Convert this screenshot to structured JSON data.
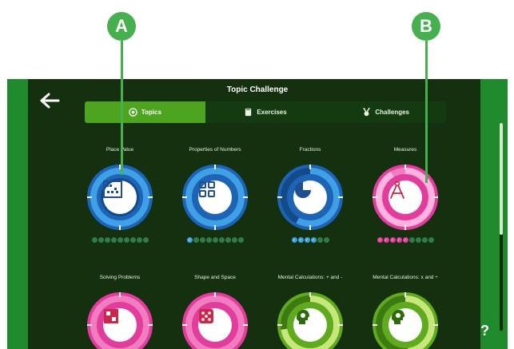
{
  "header": {
    "title": "Topic Challenge",
    "back_icon": "arrow-left-icon"
  },
  "tabs": [
    {
      "label": "Topics",
      "icon": "target-icon",
      "active": true
    },
    {
      "label": "Exercises",
      "icon": "book-icon",
      "active": false
    },
    {
      "label": "Challenges",
      "icon": "medal-icon",
      "active": false
    }
  ],
  "topics": [
    {
      "name": "Place Value",
      "color": "#1e64b4",
      "icon": "abacus-icon",
      "progress_completed": 0,
      "progress_total": 9
    },
    {
      "name": "Properties of Numbers",
      "color": "#1e64b4",
      "icon": "grid-icon",
      "progress_completed": 1,
      "progress_total": 9
    },
    {
      "name": "Fractions",
      "color": "#1e64b4",
      "icon": "pie-icon",
      "progress_completed": 4,
      "progress_total": 6
    },
    {
      "name": "Measures",
      "color": "#e23c9c",
      "icon": "compass-icon",
      "progress_completed": 5,
      "progress_total": 9
    },
    {
      "name": "Solving Problems",
      "color": "#e23c9c",
      "icon": "puzzle-icon"
    },
    {
      "name": "Shape and Space",
      "color": "#e23c9c",
      "icon": "dice-icon"
    },
    {
      "name": "Mental Calculations: + and -",
      "color": "#5faa1e",
      "icon": "head-icon"
    },
    {
      "name": "Mental Calculations: x and ÷",
      "color": "#5faa1e",
      "icon": "head-icon"
    }
  ],
  "callouts": {
    "a": "A",
    "b": "B"
  },
  "help_label": "?"
}
